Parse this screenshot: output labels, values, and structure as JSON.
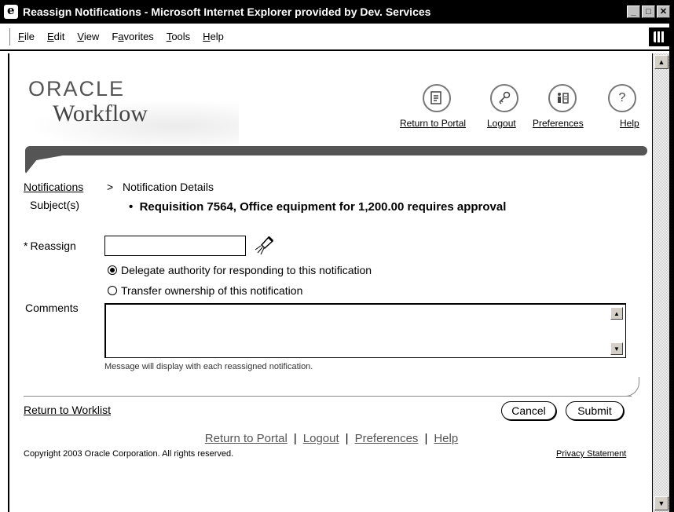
{
  "window": {
    "title": "Reassign Notifications - Microsoft Internet Explorer provided by Dev. Services",
    "minimize": "_",
    "maximize": "□",
    "close": "✕"
  },
  "menu": {
    "items": [
      {
        "label": "File",
        "accel": "F"
      },
      {
        "label": "Edit",
        "accel": "E"
      },
      {
        "label": "View",
        "accel": "V"
      },
      {
        "label": "Favorites",
        "accel": "a"
      },
      {
        "label": "Tools",
        "accel": "T"
      },
      {
        "label": "Help",
        "accel": "H"
      }
    ]
  },
  "branding": {
    "oracle": "ORACLE",
    "product": "Workflow"
  },
  "global_nav": {
    "return_to_portal": "Return to Portal",
    "logout": "Logout",
    "preferences": "Preferences",
    "help": "Help",
    "help_glyph": "?"
  },
  "breadcrumb": {
    "parent": "Notifications",
    "separator": ">",
    "current": "Notification Details"
  },
  "form": {
    "subject_label": "Subject(s)",
    "subject_value": "Requisition 7564, Office equipment for 1,200.00 requires approval",
    "required_marker": "*",
    "reassign_label": "Reassign",
    "reassign_value": "",
    "option_delegate": "Delegate authority for responding to this notification",
    "option_transfer": "Transfer ownership of this notification",
    "selected_option": "delegate",
    "comments_label": "Comments",
    "comments_value": "",
    "comments_hint": "Message will display with each reassigned notification."
  },
  "actions": {
    "return_to_worklist": "Return to Worklist",
    "cancel": "Cancel",
    "submit": "Submit"
  },
  "footer": {
    "return_to_portal": "Return to Portal",
    "logout": "Logout",
    "preferences": "Preferences",
    "help": "Help",
    "separator": "|",
    "copyright": "Copyright 2003 Oracle Corporation. All rights reserved.",
    "privacy": "Privacy Statement"
  },
  "icons": {
    "portal": "return-to-portal-icon",
    "logout": "logout-key-icon",
    "preferences": "preferences-icon",
    "help": "help-icon",
    "search": "flashlight-search-icon"
  }
}
